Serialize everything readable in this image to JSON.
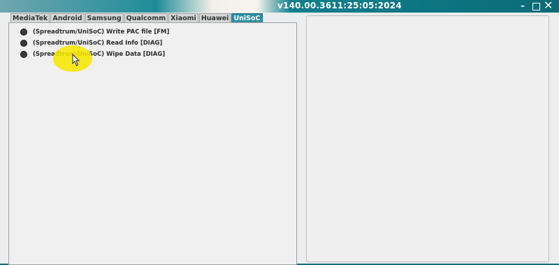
{
  "window": {
    "title": "v140.00.3611:25:05:2024",
    "controls": {
      "minimize": "–",
      "close": "✕"
    }
  },
  "tabs": [
    {
      "label": "MediaTek",
      "active": false
    },
    {
      "label": "Android",
      "active": false
    },
    {
      "label": "Samsung",
      "active": false
    },
    {
      "label": "Qualcomm",
      "active": false
    },
    {
      "label": "Xiaomi",
      "active": false
    },
    {
      "label": "Huawei",
      "active": false
    },
    {
      "label": "UniSoC",
      "active": true
    }
  ],
  "operations": [
    {
      "label": "(Spreadtrum/UniSoC) Write PAC file [FM]"
    },
    {
      "label": "(Spreadtrum/UniSoC) Read Info [DIAG]"
    },
    {
      "label": "(Spreadtrum/UniSoC) Wipe Data [DIAG]"
    }
  ],
  "colors": {
    "titlebar": "#0f7f8c",
    "active_tab": "#2b8ea1",
    "panel_bg": "#f0f0f0",
    "cursor_highlight": "#f6e700"
  },
  "icons": {
    "minimize": "minimize-icon",
    "maximize": "maximize-icon",
    "close": "close-icon",
    "cursor": "mouse-pointer-icon",
    "radio": "radio-bullet-icon"
  }
}
